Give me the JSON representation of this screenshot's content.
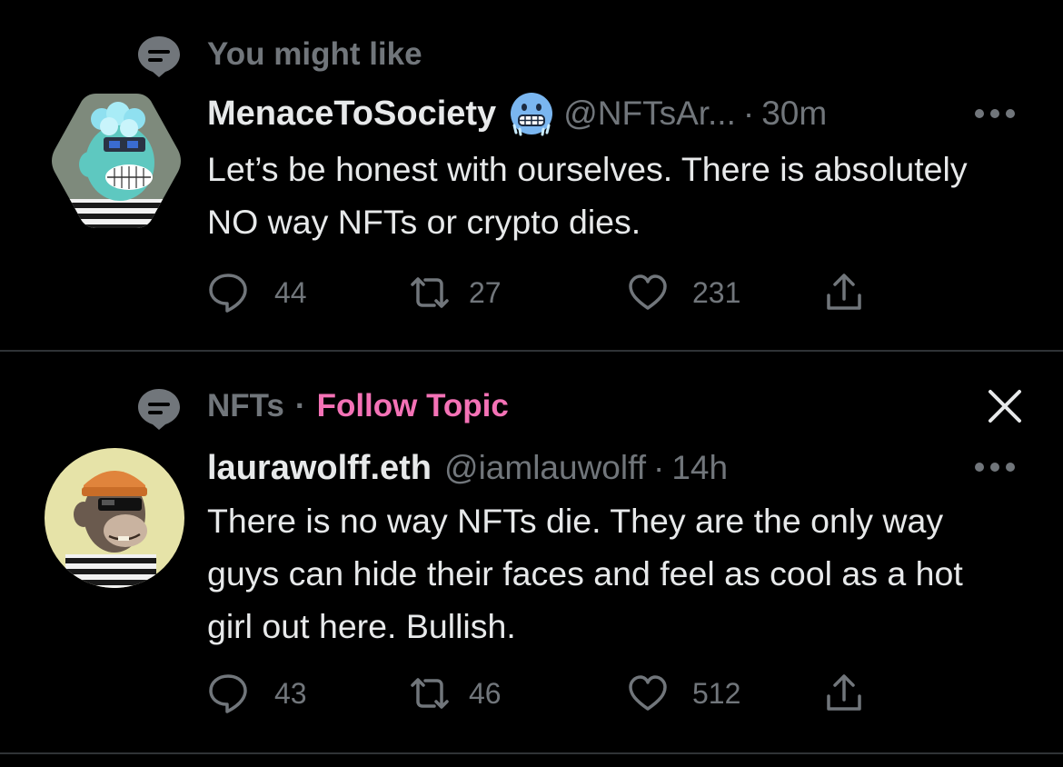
{
  "tweets": [
    {
      "context": {
        "label": "You might like",
        "icon": "topic-bubble-icon"
      },
      "author": {
        "display_name": "MenaceToSociety",
        "badge_emoji": "cold-face-emoji",
        "handle": "@NFTsAr...",
        "separator": "·",
        "time": "30m",
        "avatar": "bored-ape-avatar-blue-fur"
      },
      "text": "Let’s be honest with ourselves. There is absolutely NO way NFTs or crypto dies.",
      "actions": {
        "replies": "44",
        "retweets": "27",
        "likes": "231"
      }
    },
    {
      "context": {
        "topic": "NFTs",
        "separator": "·",
        "follow_label": "Follow Topic",
        "icon": "topic-bubble-icon"
      },
      "author": {
        "display_name": "laurawolff.eth",
        "handle": "@iamlauwolff",
        "separator": "·",
        "time": "14h",
        "avatar": "bored-ape-avatar-orange-beanie"
      },
      "text": "There is no way NFTs die. They are the only way guys can hide their faces and feel as cool as a hot girl out here. Bullish.",
      "actions": {
        "replies": "43",
        "retweets": "46",
        "likes": "512"
      }
    }
  ],
  "colors": {
    "background": "#000000",
    "primary_text": "#e7e9ea",
    "secondary_text": "#71767b",
    "divider": "#2f3336",
    "follow_topic": "#f472b6"
  }
}
